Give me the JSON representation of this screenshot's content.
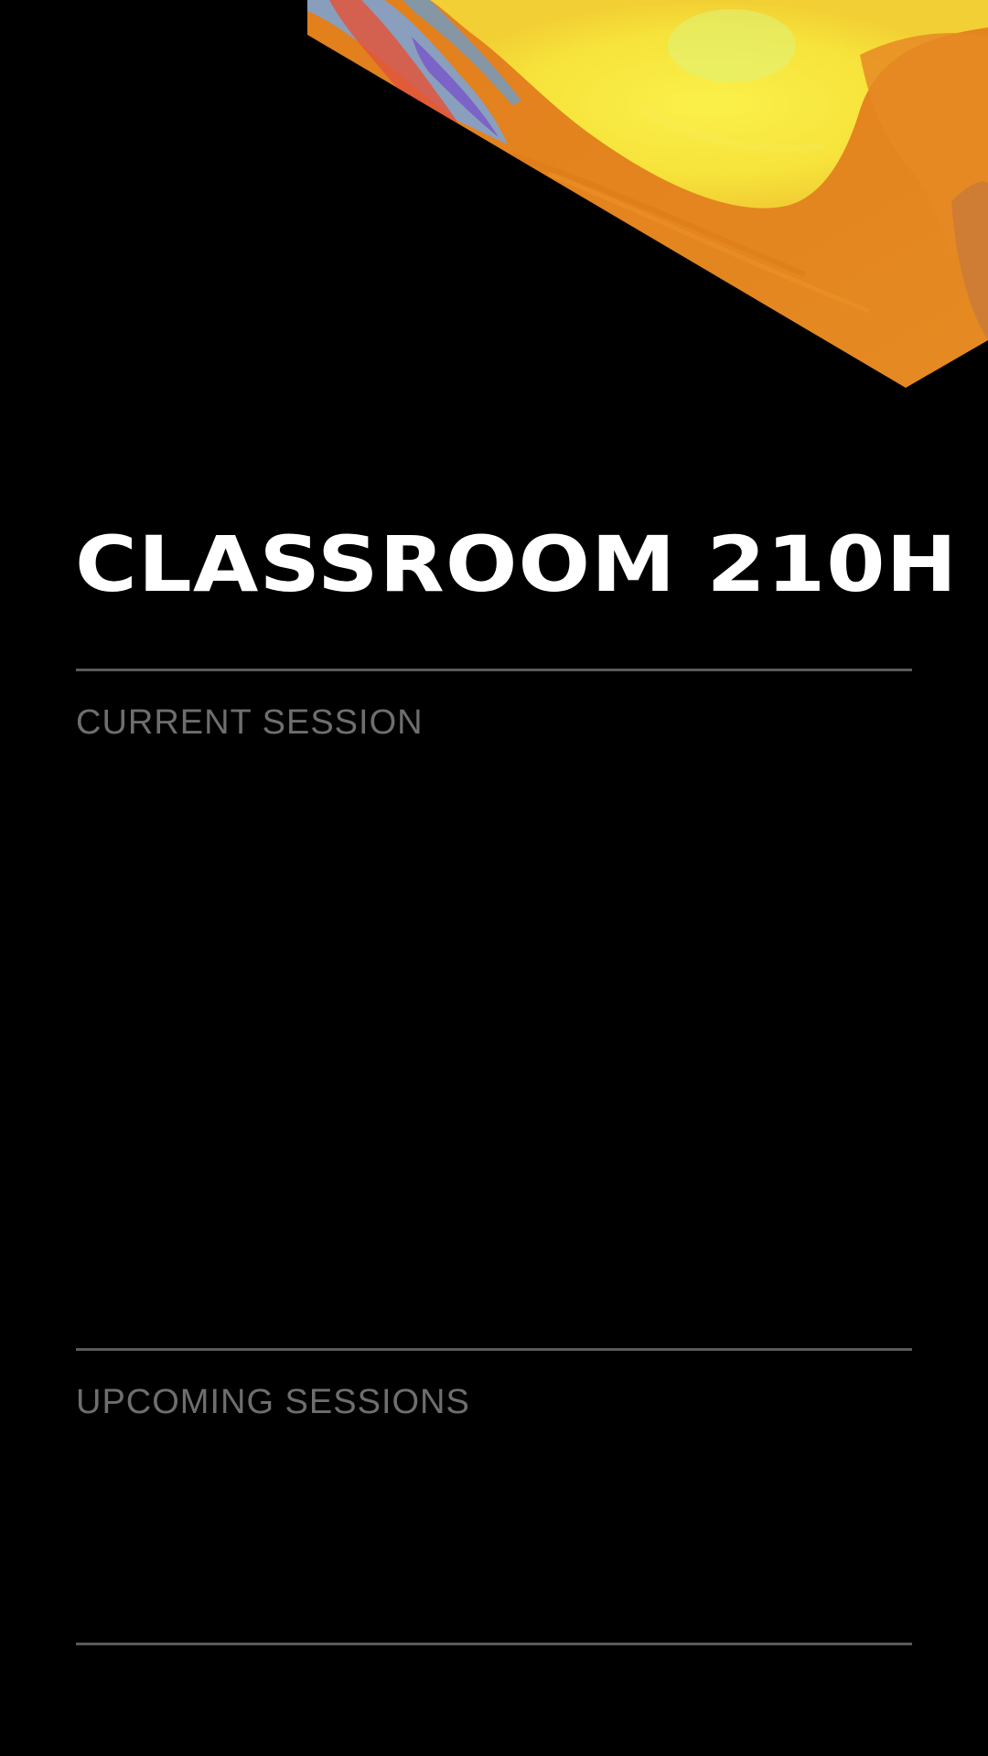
{
  "room": {
    "title": "CLASSROOM 210H"
  },
  "sections": {
    "current": {
      "label": "CURRENT SESSION"
    },
    "upcoming": {
      "label": "UPCOMING SESSIONS"
    }
  },
  "colors": {
    "background": "#000000",
    "title": "#ffffff",
    "label": "#6e6e6e",
    "divider": "#5a5a5a",
    "art_orange": "#e88a1f",
    "art_yellow": "#f5e43a",
    "art_blue": "#6f9fd8",
    "art_red": "#e2553c",
    "art_purple": "#7a5cc8"
  }
}
